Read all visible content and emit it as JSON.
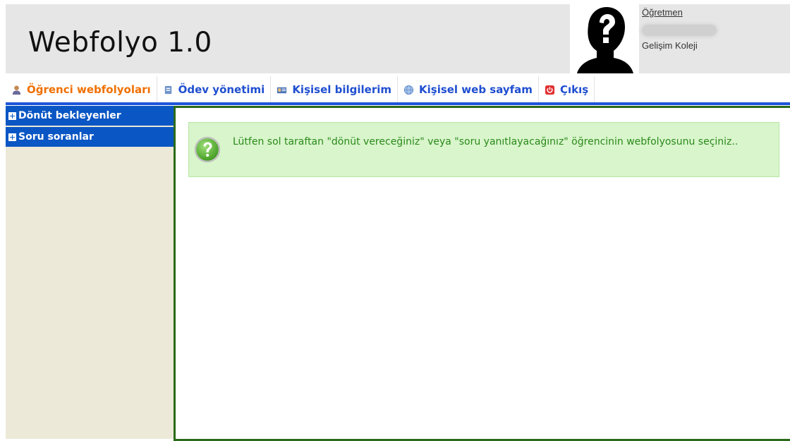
{
  "header": {
    "app_title": "Webfolyo 1.0",
    "user_role": "Öğretmen",
    "user_school": "Gelişim Koleji"
  },
  "tabs": [
    {
      "label": "Öğrenci webfolyoları",
      "icon": "student-icon",
      "active": true
    },
    {
      "label": "Ödev yönetimi",
      "icon": "homework-icon",
      "active": false
    },
    {
      "label": "Kişisel bilgilerim",
      "icon": "id-card-icon",
      "active": false
    },
    {
      "label": "Kişisel web sayfam",
      "icon": "globe-icon",
      "active": false
    },
    {
      "label": "Çıkış",
      "icon": "power-icon",
      "active": false
    }
  ],
  "sidebar": {
    "items": [
      {
        "label": "Dönüt bekleyenler",
        "icon": "plus-icon"
      },
      {
        "label": "Soru soranlar",
        "icon": "plus-icon"
      }
    ]
  },
  "notice": {
    "text": "Lütfen sol taraftan \"dönüt vereceğiniz\" veya \"soru yanıtlayacağınız\" öğrencinin webfolyosunu seçiniz..",
    "icon": "question-icon"
  },
  "colors": {
    "header_bg": "#e6e6e6",
    "tab_active": "#f07000",
    "tab_text": "#1f4fd0",
    "nav_blue": "#1d55d8",
    "sidebar_item_bg": "#0a56c4",
    "sidebar_bg": "#ece9d8",
    "main_border": "#2a6a1a",
    "notice_bg": "#d9f5cc",
    "notice_text": "#2a8a1a"
  }
}
